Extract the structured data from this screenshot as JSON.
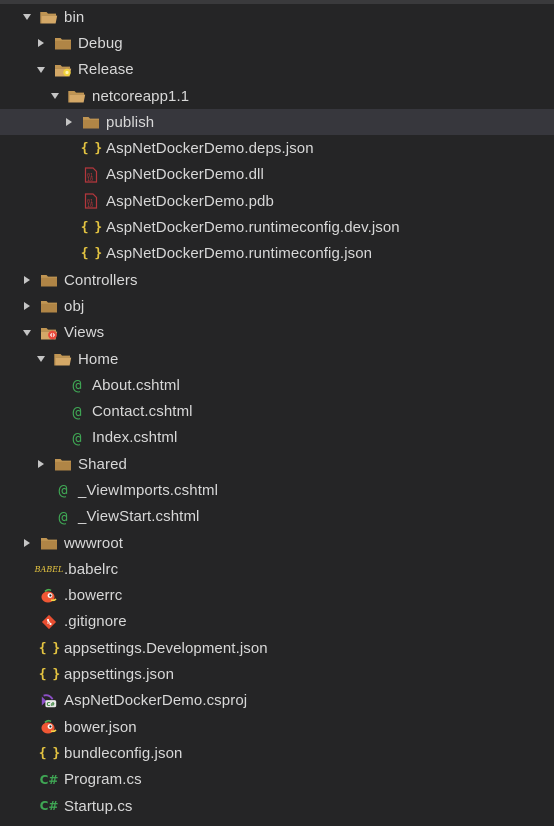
{
  "explorer": {
    "items": [
      {
        "label": "bin",
        "depth": 0,
        "twisty": "down",
        "icon": "folder-open-icon",
        "iconType": "folder-open"
      },
      {
        "label": "Debug",
        "depth": 1,
        "twisty": "right",
        "icon": "folder-icon",
        "iconType": "folder"
      },
      {
        "label": "Release",
        "depth": 1,
        "twisty": "down",
        "icon": "folder-release-icon",
        "iconType": "folder-release"
      },
      {
        "label": "netcoreapp1.1",
        "depth": 2,
        "twisty": "down",
        "icon": "folder-open-icon",
        "iconType": "folder-open"
      },
      {
        "label": "publish",
        "depth": 3,
        "twisty": "right",
        "icon": "folder-icon",
        "iconType": "folder",
        "selected": true
      },
      {
        "label": "AspNetDockerDemo.deps.json",
        "depth": 3,
        "twisty": "none",
        "icon": "json-file-icon",
        "iconType": "json"
      },
      {
        "label": "AspNetDockerDemo.dll",
        "depth": 3,
        "twisty": "none",
        "icon": "binary-file-icon",
        "iconType": "binary"
      },
      {
        "label": "AspNetDockerDemo.pdb",
        "depth": 3,
        "twisty": "none",
        "icon": "binary-file-icon",
        "iconType": "binary"
      },
      {
        "label": "AspNetDockerDemo.runtimeconfig.dev.json",
        "depth": 3,
        "twisty": "none",
        "icon": "json-file-icon",
        "iconType": "json"
      },
      {
        "label": "AspNetDockerDemo.runtimeconfig.json",
        "depth": 3,
        "twisty": "none",
        "icon": "json-file-icon",
        "iconType": "json"
      },
      {
        "label": "Controllers",
        "depth": 0,
        "twisty": "right",
        "icon": "folder-icon",
        "iconType": "folder"
      },
      {
        "label": "obj",
        "depth": 0,
        "twisty": "right",
        "icon": "folder-icon",
        "iconType": "folder"
      },
      {
        "label": "Views",
        "depth": 0,
        "twisty": "down",
        "icon": "folder-views-icon",
        "iconType": "folder-views"
      },
      {
        "label": "Home",
        "depth": 1,
        "twisty": "down",
        "icon": "folder-open-icon",
        "iconType": "folder-open"
      },
      {
        "label": "About.cshtml",
        "depth": 2,
        "twisty": "none",
        "icon": "razor-file-icon",
        "iconType": "razor"
      },
      {
        "label": "Contact.cshtml",
        "depth": 2,
        "twisty": "none",
        "icon": "razor-file-icon",
        "iconType": "razor"
      },
      {
        "label": "Index.cshtml",
        "depth": 2,
        "twisty": "none",
        "icon": "razor-file-icon",
        "iconType": "razor"
      },
      {
        "label": "Shared",
        "depth": 1,
        "twisty": "right",
        "icon": "folder-icon",
        "iconType": "folder"
      },
      {
        "label": "_ViewImports.cshtml",
        "depth": 1,
        "twisty": "none",
        "icon": "razor-file-icon",
        "iconType": "razor"
      },
      {
        "label": "_ViewStart.cshtml",
        "depth": 1,
        "twisty": "none",
        "icon": "razor-file-icon",
        "iconType": "razor"
      },
      {
        "label": "wwwroot",
        "depth": 0,
        "twisty": "right",
        "icon": "folder-icon",
        "iconType": "folder"
      },
      {
        "label": ".babelrc",
        "depth": 0,
        "twisty": "none",
        "icon": "babel-file-icon",
        "iconType": "babel"
      },
      {
        "label": ".bowerrc",
        "depth": 0,
        "twisty": "none",
        "icon": "bower-file-icon",
        "iconType": "bower"
      },
      {
        "label": ".gitignore",
        "depth": 0,
        "twisty": "none",
        "icon": "git-file-icon",
        "iconType": "git"
      },
      {
        "label": "appsettings.Development.json",
        "depth": 0,
        "twisty": "none",
        "icon": "json-file-icon",
        "iconType": "json"
      },
      {
        "label": "appsettings.json",
        "depth": 0,
        "twisty": "none",
        "icon": "json-file-icon",
        "iconType": "json"
      },
      {
        "label": "AspNetDockerDemo.csproj",
        "depth": 0,
        "twisty": "none",
        "icon": "csproj-file-icon",
        "iconType": "csproj"
      },
      {
        "label": "bower.json",
        "depth": 0,
        "twisty": "none",
        "icon": "bower-file-icon",
        "iconType": "bower"
      },
      {
        "label": "bundleconfig.json",
        "depth": 0,
        "twisty": "none",
        "icon": "json-file-icon",
        "iconType": "json"
      },
      {
        "label": "Program.cs",
        "depth": 0,
        "twisty": "none",
        "icon": "csharp-file-icon",
        "iconType": "csharp"
      },
      {
        "label": "Startup.cs",
        "depth": 0,
        "twisty": "none",
        "icon": "csharp-file-icon",
        "iconType": "csharp"
      }
    ]
  },
  "colors": {
    "background": "#252526",
    "selection": "#37373d",
    "text": "#d8d8d8",
    "folder": "#c09553",
    "json": "#e4c441",
    "razor": "#3fa654",
    "binary": "#b4373c"
  }
}
